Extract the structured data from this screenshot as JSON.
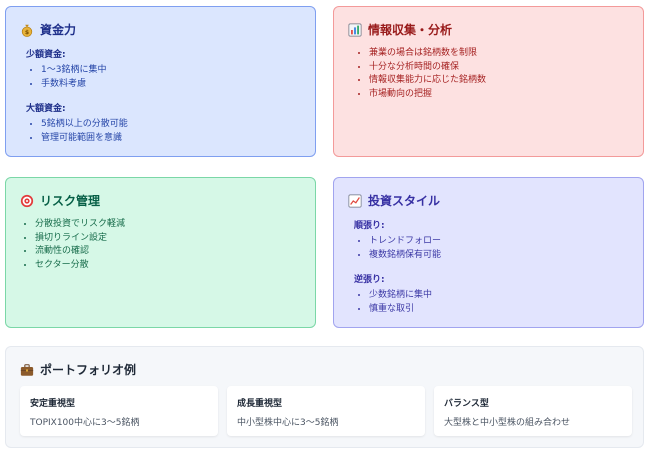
{
  "funds": {
    "title": "資金力",
    "icon": "money-bag-icon",
    "small": {
      "heading": "少額資金:",
      "items": [
        "1〜3銘柄に集中",
        "手数料考慮"
      ]
    },
    "large": {
      "heading": "大額資金:",
      "items": [
        "5銘柄以上の分散可能",
        "管理可能範囲を意識"
      ]
    }
  },
  "info": {
    "title": "情報収集・分析",
    "icon": "bar-chart-icon",
    "items": [
      "兼業の場合は銘柄数を制限",
      "十分な分析時間の確保",
      "情報収集能力に応じた銘柄数",
      "市場動向の把握"
    ]
  },
  "risk": {
    "title": "リスク管理",
    "icon": "target-icon",
    "items": [
      "分散投資でリスク軽減",
      "損切りライン設定",
      "流動性の確認",
      "セクター分散"
    ]
  },
  "style": {
    "title": "投資スタイル",
    "icon": "trend-chart-icon",
    "trend": {
      "heading": "順張り:",
      "items": [
        "トレンドフォロー",
        "複数銘柄保有可能"
      ]
    },
    "contrarian": {
      "heading": "逆張り:",
      "items": [
        "少数銘柄に集中",
        "慎重な取引"
      ]
    }
  },
  "portfolio": {
    "title": "ポートフォリオ例",
    "icon": "briefcase-icon",
    "items": [
      {
        "name": "安定重視型",
        "desc": "TOPIX100中心に3〜5銘柄"
      },
      {
        "name": "成長重視型",
        "desc": "中小型株中心に3〜5銘柄"
      },
      {
        "name": "バランス型",
        "desc": "大型株と中小型株の組み合わせ"
      }
    ]
  },
  "colors": {
    "blue_bg": "#dbe6fe",
    "red_bg": "#fde1e1",
    "green_bg": "#d6f8e7",
    "indigo_bg": "#e2e4fe",
    "portfolio_bg": "#f5f7fa"
  }
}
